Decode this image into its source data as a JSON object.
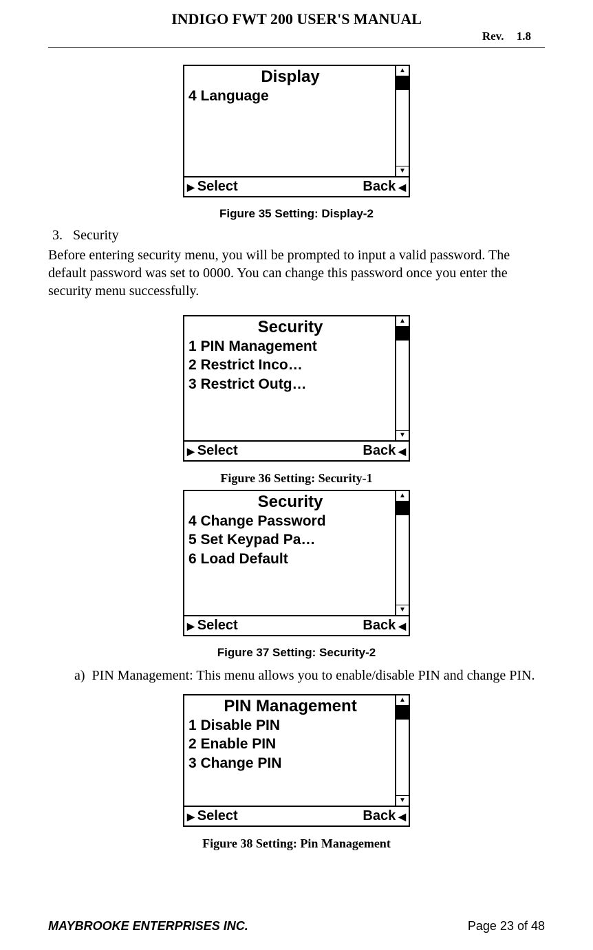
{
  "header": {
    "title": "INDIGO FWT 200 USER'S MANUAL",
    "rev_label": "Rev.",
    "rev_value": "1.8"
  },
  "screen1": {
    "title": "Display",
    "line1": "4 Language",
    "select": "Select",
    "back": "Back"
  },
  "caption1": "Figure 35 Setting: Display-2",
  "section3": {
    "num": "3.",
    "label": "Security",
    "body": "Before entering security menu, you will be prompted to input a valid password. The default password was set to 0000. You can change this password once you enter the security menu successfully."
  },
  "screen2": {
    "title": "Security",
    "line1": "1 PIN Management",
    "line2": "2 Restrict Inco…",
    "line3": "3 Restrict Outg…",
    "select": "Select",
    "back": "Back"
  },
  "caption2": "Figure 36 Setting: Security-1",
  "screen3": {
    "title": "Security",
    "line1": "4 Change Password",
    "line2": "5 Set Keypad Pa…",
    "line3": "6 Load Default",
    "select": "Select",
    "back": "Back"
  },
  "caption3": "Figure 37  Setting: Security-2",
  "item_a": {
    "marker": "a)",
    "text": "PIN Management: This menu allows you to enable/disable PIN and change PIN."
  },
  "screen4": {
    "title": "PIN Management",
    "line1": "1 Disable PIN",
    "line2": "2 Enable  PIN",
    "line3": "3 Change PIN",
    "select": "Select",
    "back": "Back"
  },
  "caption4": "Figure 38 Setting: Pin Management",
  "footer": {
    "left": "MAYBROOKE ENTERPRISES INC.",
    "right": "Page 23 of 48"
  }
}
